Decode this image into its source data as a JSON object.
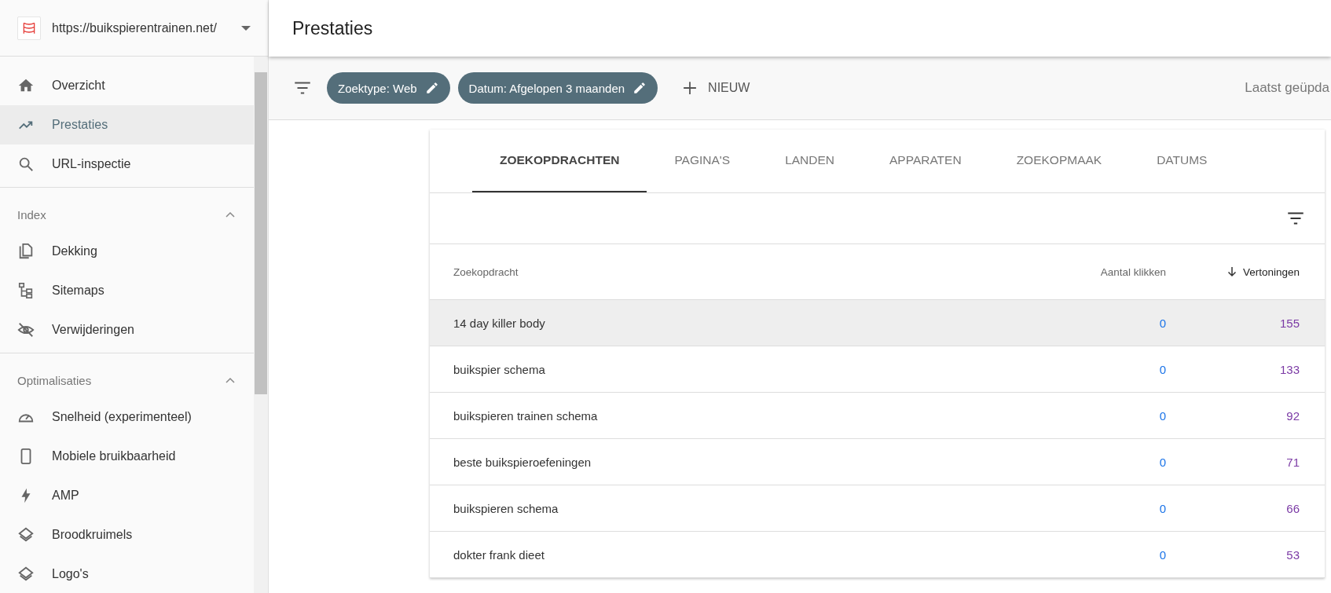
{
  "property": {
    "url": "https://buikspierentrainen.net/"
  },
  "sidebar": {
    "items": [
      {
        "label": "Overzicht",
        "kind": "home",
        "selected": false
      },
      {
        "label": "Prestaties",
        "kind": "trend",
        "selected": true
      },
      {
        "label": "URL-inspectie",
        "kind": "search",
        "selected": false
      }
    ],
    "sections": [
      {
        "title": "Index",
        "expanded": true,
        "items": [
          {
            "label": "Dekking",
            "kind": "copy",
            "selected": false
          },
          {
            "label": "Sitemaps",
            "kind": "sitemap",
            "selected": false
          },
          {
            "label": "Verwijderingen",
            "kind": "eye",
            "selected": false
          }
        ]
      },
      {
        "title": "Optimalisaties",
        "expanded": true,
        "items": [
          {
            "label": "Snelheid (experimenteel)",
            "kind": "gauge",
            "selected": false
          },
          {
            "label": "Mobiele bruikbaarheid",
            "kind": "phone",
            "selected": false
          },
          {
            "label": "AMP",
            "kind": "bolt",
            "selected": false
          },
          {
            "label": "Broodkruimels",
            "kind": "layers",
            "selected": false
          },
          {
            "label": "Logo's",
            "kind": "layers",
            "selected": false
          }
        ]
      }
    ]
  },
  "page": {
    "title": "Prestaties"
  },
  "filters": {
    "chips": [
      "Zoektype: Web",
      "Datum: Afgelopen 3 maanden"
    ],
    "new_button": "NIEUW",
    "last_updated": "Laatst geüpda"
  },
  "tabs": [
    {
      "label": "ZOEKOPDRACHTEN",
      "selected": true
    },
    {
      "label": "PAGINA'S",
      "selected": false
    },
    {
      "label": "LANDEN",
      "selected": false
    },
    {
      "label": "APPARATEN",
      "selected": false
    },
    {
      "label": "ZOEKOPMAAK",
      "selected": false
    },
    {
      "label": "DATUMS",
      "selected": false
    }
  ],
  "table": {
    "columns": [
      "Zoekopdracht",
      "Aantal klikken",
      "Vertoningen"
    ],
    "rows": [
      {
        "query": "14 day killer body",
        "clicks": "0",
        "impressions": "155",
        "selected": true
      },
      {
        "query": "buikspier schema",
        "clicks": "0",
        "impressions": "133",
        "selected": false
      },
      {
        "query": "buikspieren trainen schema",
        "clicks": "0",
        "impressions": "92",
        "selected": false
      },
      {
        "query": "beste buikspieroefeningen",
        "clicks": "0",
        "impressions": "71",
        "selected": false
      },
      {
        "query": "buikspieren schema",
        "clicks": "0",
        "impressions": "66",
        "selected": false
      },
      {
        "query": "dokter frank dieet",
        "clicks": "0",
        "impressions": "53",
        "selected": false
      }
    ]
  }
}
